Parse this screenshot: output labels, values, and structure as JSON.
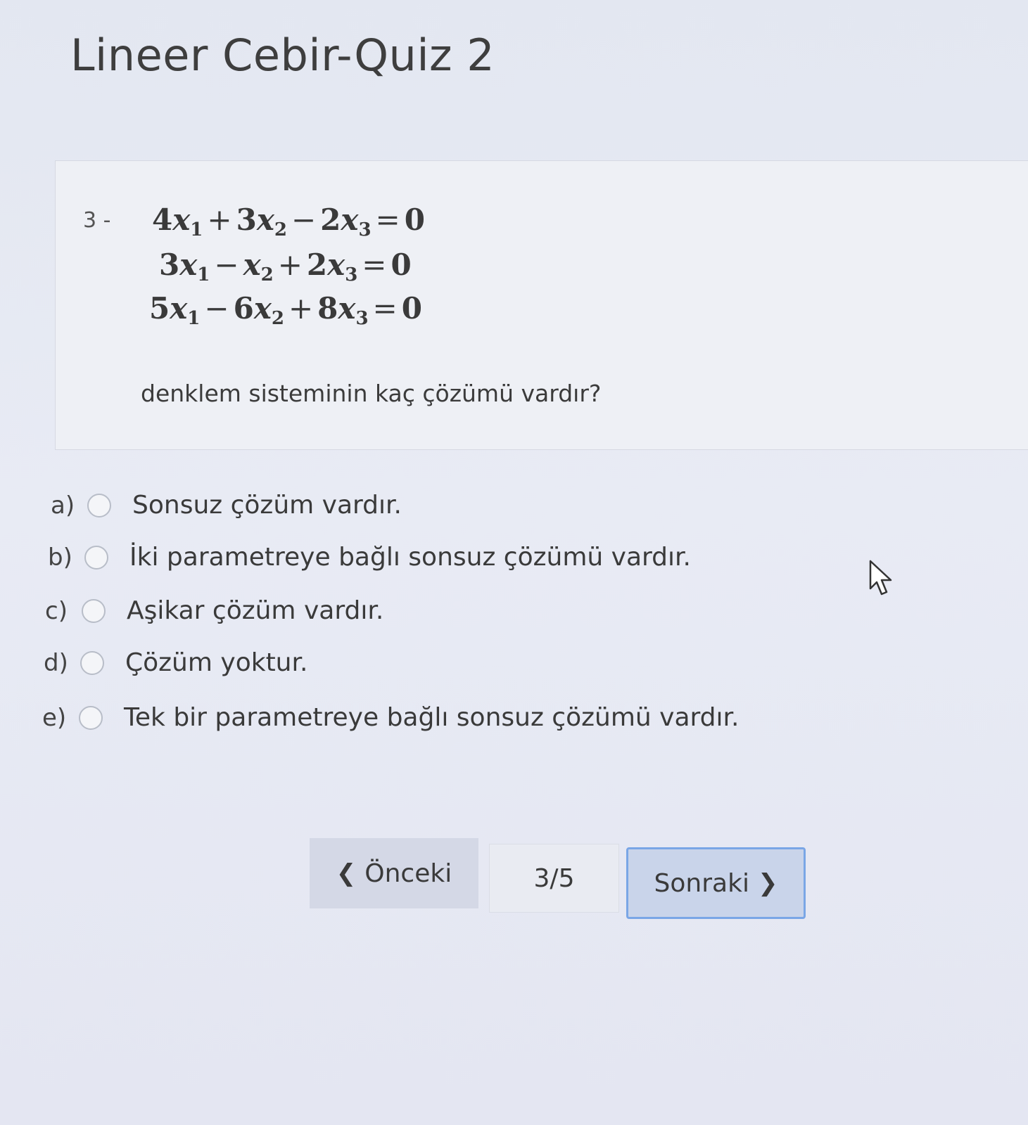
{
  "page": {
    "title": "Lineer Cebir-Quiz 2"
  },
  "question": {
    "number": "3 -",
    "equations": [
      {
        "c1": "4",
        "s1": "+",
        "c2": "3",
        "s2": "−",
        "c3": "2",
        "rhs": "0"
      },
      {
        "c1": "3",
        "s1": "−",
        "c2": "",
        "s2": "+",
        "c3": "2",
        "rhs": "0"
      },
      {
        "c1": "5",
        "s1": "−",
        "c2": "6",
        "s2": "+",
        "c3": "8",
        "rhs": "0"
      }
    ],
    "prompt": "denklem sisteminin kaç çözümü vardır?"
  },
  "options": [
    {
      "letter": "a)",
      "text": "Sonsuz çözüm vardır."
    },
    {
      "letter": "b)",
      "text": "İki parametreye bağlı sonsuz çözümü vardır."
    },
    {
      "letter": "c)",
      "text": "Aşikar çözüm vardır."
    },
    {
      "letter": "d)",
      "text": "Çözüm yoktur."
    },
    {
      "letter": "e)",
      "text": "Tek bir parametreye bağlı sonsuz çözümü vardır."
    }
  ],
  "navigation": {
    "prev_label": "Önceki",
    "prev_icon": "chevron-left-icon",
    "counter": "3/5",
    "next_label": "Sonraki",
    "next_icon": "chevron-right-icon"
  }
}
